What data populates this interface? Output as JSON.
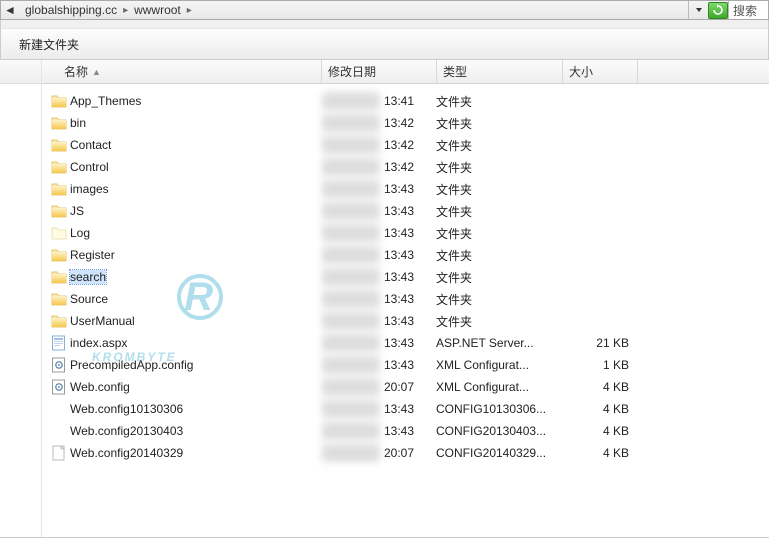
{
  "address": {
    "seg1": "globalshipping.cc",
    "seg2": "wwwroot"
  },
  "search_label": "搜索",
  "toolbar": {
    "new_folder": "新建文件夹"
  },
  "columns": {
    "name": "名称",
    "date": "修改日期",
    "type": "类型",
    "size": "大小"
  },
  "files": [
    {
      "icon": "folder",
      "name": "App_Themes",
      "time": "13:41",
      "type": "文件夹",
      "size": ""
    },
    {
      "icon": "folder",
      "name": "bin",
      "time": "13:42",
      "type": "文件夹",
      "size": ""
    },
    {
      "icon": "folder",
      "name": "Contact",
      "time": "13:42",
      "type": "文件夹",
      "size": ""
    },
    {
      "icon": "folder",
      "name": "Control",
      "time": "13:42",
      "type": "文件夹",
      "size": ""
    },
    {
      "icon": "folder",
      "name": "images",
      "time": "13:43",
      "type": "文件夹",
      "size": ""
    },
    {
      "icon": "folder",
      "name": "JS",
      "time": "13:43",
      "type": "文件夹",
      "size": ""
    },
    {
      "icon": "folder-light",
      "name": "Log",
      "time": "13:43",
      "type": "文件夹",
      "size": ""
    },
    {
      "icon": "folder",
      "name": "Register",
      "time": "13:43",
      "type": "文件夹",
      "size": ""
    },
    {
      "icon": "folder",
      "name": "search",
      "time": "13:43",
      "type": "文件夹",
      "size": "",
      "selected": true
    },
    {
      "icon": "folder",
      "name": "Source",
      "time": "13:43",
      "type": "文件夹",
      "size": ""
    },
    {
      "icon": "folder",
      "name": "UserManual",
      "time": "13:43",
      "type": "文件夹",
      "size": ""
    },
    {
      "icon": "aspx",
      "name": "index.aspx",
      "time": "13:43",
      "type": "ASP.NET Server...",
      "size": "21 KB"
    },
    {
      "icon": "config",
      "name": "PrecompiledApp.config",
      "time": "13:43",
      "type": "XML Configurat...",
      "size": "1 KB"
    },
    {
      "icon": "config",
      "name": "Web.config",
      "time": "20:07",
      "type": "XML Configurat...",
      "size": "4 KB"
    },
    {
      "icon": "blank",
      "name": "Web.config10130306",
      "time": "13:43",
      "type": "CONFIG10130306...",
      "size": "4 KB"
    },
    {
      "icon": "blank",
      "name": "Web.config20130403",
      "time": "13:43",
      "type": "CONFIG20130403...",
      "size": "4 KB"
    },
    {
      "icon": "file",
      "name": "Web.config20140329",
      "time": "20:07",
      "type": "CONFIG20140329...",
      "size": "4 KB"
    }
  ],
  "watermark": "KROMBYTE"
}
